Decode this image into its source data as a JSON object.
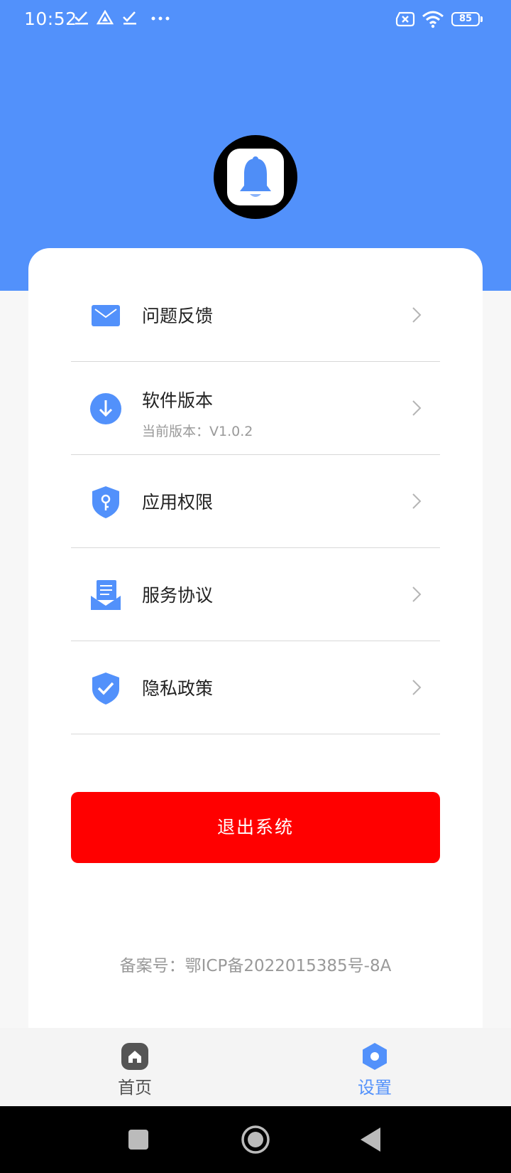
{
  "status_bar": {
    "time": "10:52",
    "battery": "85"
  },
  "menu": [
    {
      "icon": "mail-icon",
      "title": "问题反馈"
    },
    {
      "icon": "download-icon",
      "title": "软件版本",
      "subtitle": "当前版本：V1.0.2"
    },
    {
      "icon": "shield-key-icon",
      "title": "应用权限"
    },
    {
      "icon": "document-icon",
      "title": "服务协议"
    },
    {
      "icon": "shield-check-icon",
      "title": "隐私政策"
    }
  ],
  "logout_label": "退出系统",
  "icp": "备案号：鄂ICP备2022015385号-8A",
  "tabbar": {
    "home_label": "首页",
    "settings_label": "设置"
  },
  "colors": {
    "primary": "#5291fb",
    "danger": "#ff0000",
    "tab_inactive": "#555555"
  }
}
